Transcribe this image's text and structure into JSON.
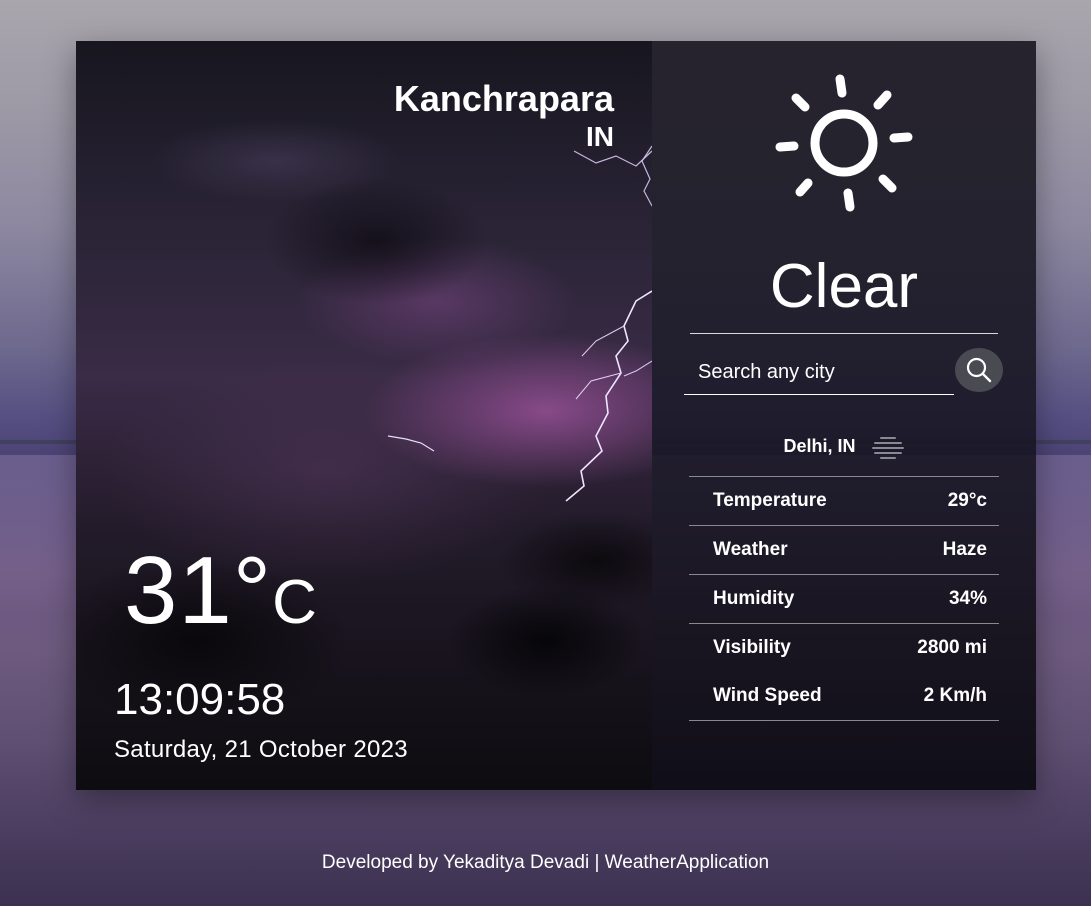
{
  "location": {
    "city": "Kanchrapara",
    "country": "IN"
  },
  "current": {
    "temperature": "31",
    "degree_symbol": "°",
    "unit": "C",
    "time": "13:09:58",
    "date": "Saturday, 21 October 2023"
  },
  "condition": {
    "label": "Clear",
    "icon": "sun-icon"
  },
  "search": {
    "placeholder": "Search any city",
    "button_icon": "search-icon"
  },
  "result": {
    "location": "Delhi, IN",
    "icon": "haze-icon",
    "stats": [
      {
        "label": "Temperature",
        "value": "29°c"
      },
      {
        "label": "Weather",
        "value": "Haze"
      },
      {
        "label": "Humidity",
        "value": "34%"
      },
      {
        "label": "Visibility",
        "value": "2800 mi"
      },
      {
        "label": "Wind Speed",
        "value": "2 Km/h"
      }
    ]
  },
  "footer": {
    "text": "Developed by Yekaditya Devadi | WeatherApplication"
  }
}
